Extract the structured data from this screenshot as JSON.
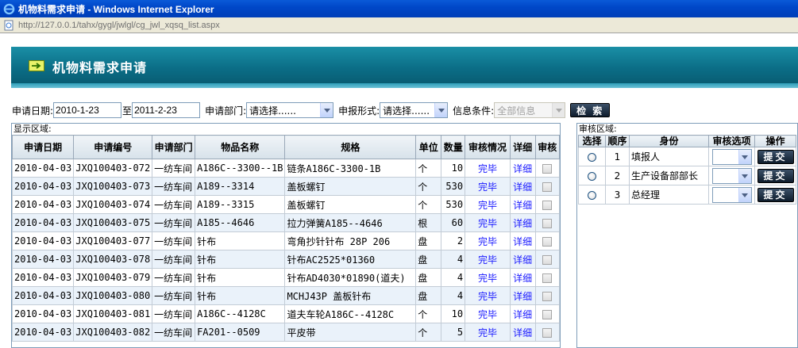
{
  "window": {
    "title": "机物料需求申请 - Windows Internet Explorer",
    "address": "http://127.0.0.1/tahx/gygl/jwlgl/cg_jwl_xqsq_list.aspx"
  },
  "banner": {
    "title": "机物料需求申请"
  },
  "search": {
    "date_label": "申请日期:",
    "date_from": "2010-1-23",
    "to_label": "至",
    "date_to": "2011-2-23",
    "dept_label": "申请部门:",
    "dept_value": "请选择......",
    "form_label": "申报形式:",
    "form_value": "请选择......",
    "info_label": "信息条件:",
    "info_value": "全部信息",
    "search_button": "检 索"
  },
  "left": {
    "caption": "显示区域:",
    "columns": {
      "date": "申请日期",
      "code": "申请编号",
      "dept": "申请部门",
      "name": "物品名称",
      "spec": "规格",
      "unit": "单位",
      "qty": "数量",
      "status": "审核情况",
      "detail": "详细",
      "audit": "审核"
    },
    "rows": [
      {
        "date": "2010-04-03",
        "code": "JXQ100403-072",
        "dept": "一纺车间",
        "name": "A186C--3300--1B",
        "spec": "链条A186C-3300-1B",
        "unit": "个",
        "qty": "10",
        "status": "完毕",
        "detail": "详细"
      },
      {
        "date": "2010-04-03",
        "code": "JXQ100403-073",
        "dept": "一纺车间",
        "name": "A189--3314",
        "spec": "盖板螺钉",
        "unit": "个",
        "qty": "530",
        "status": "完毕",
        "detail": "详细"
      },
      {
        "date": "2010-04-03",
        "code": "JXQ100403-074",
        "dept": "一纺车间",
        "name": "A189--3315",
        "spec": "盖板螺钉",
        "unit": "个",
        "qty": "530",
        "status": "完毕",
        "detail": "详细"
      },
      {
        "date": "2010-04-03",
        "code": "JXQ100403-075",
        "dept": "一纺车间",
        "name": "A185--4646",
        "spec": "拉力弹簧A185--4646",
        "unit": "根",
        "qty": "60",
        "status": "完毕",
        "detail": "详细"
      },
      {
        "date": "2010-04-03",
        "code": "JXQ100403-077",
        "dept": "一纺车间",
        "name": "针布",
        "spec": "弯角抄针针布 28P 206",
        "unit": "盘",
        "qty": "2",
        "status": "完毕",
        "detail": "详细"
      },
      {
        "date": "2010-04-03",
        "code": "JXQ100403-078",
        "dept": "一纺车间",
        "name": "针布",
        "spec": "针布AC2525*01360",
        "unit": "盘",
        "qty": "4",
        "status": "完毕",
        "detail": "详细"
      },
      {
        "date": "2010-04-03",
        "code": "JXQ100403-079",
        "dept": "一纺车间",
        "name": "针布",
        "spec": "针布AD4030*01890(道夫)",
        "unit": "盘",
        "qty": "4",
        "status": "完毕",
        "detail": "详细"
      },
      {
        "date": "2010-04-03",
        "code": "JXQ100403-080",
        "dept": "一纺车间",
        "name": "针布",
        "spec": "MCHJ43P 盖板针布",
        "unit": "盘",
        "qty": "4",
        "status": "完毕",
        "detail": "详细"
      },
      {
        "date": "2010-04-03",
        "code": "JXQ100403-081",
        "dept": "一纺车间",
        "name": "A186C--4128C",
        "spec": "道夫车轮A186C--4128C",
        "unit": "个",
        "qty": "10",
        "status": "完毕",
        "detail": "详细"
      },
      {
        "date": "2010-04-03",
        "code": "JXQ100403-082",
        "dept": "一纺车间",
        "name": "FA201--0509",
        "spec": "平皮带",
        "unit": "个",
        "qty": "5",
        "status": "完毕",
        "detail": "详细"
      }
    ]
  },
  "right": {
    "caption": "审核区域:",
    "columns": {
      "select": "选择",
      "order": "顺序",
      "role": "身份",
      "option": "审核选项",
      "action": "操作"
    },
    "rows": [
      {
        "order": "1",
        "role": "填报人",
        "button": "提交"
      },
      {
        "order": "2",
        "role": "生产设备部部长",
        "button": "提交"
      },
      {
        "order": "3",
        "role": "总经理",
        "button": "提交"
      }
    ]
  },
  "colors": {
    "banner": "#0b6d86",
    "link": "#1a1aff",
    "titlebar": "#0047c8"
  }
}
